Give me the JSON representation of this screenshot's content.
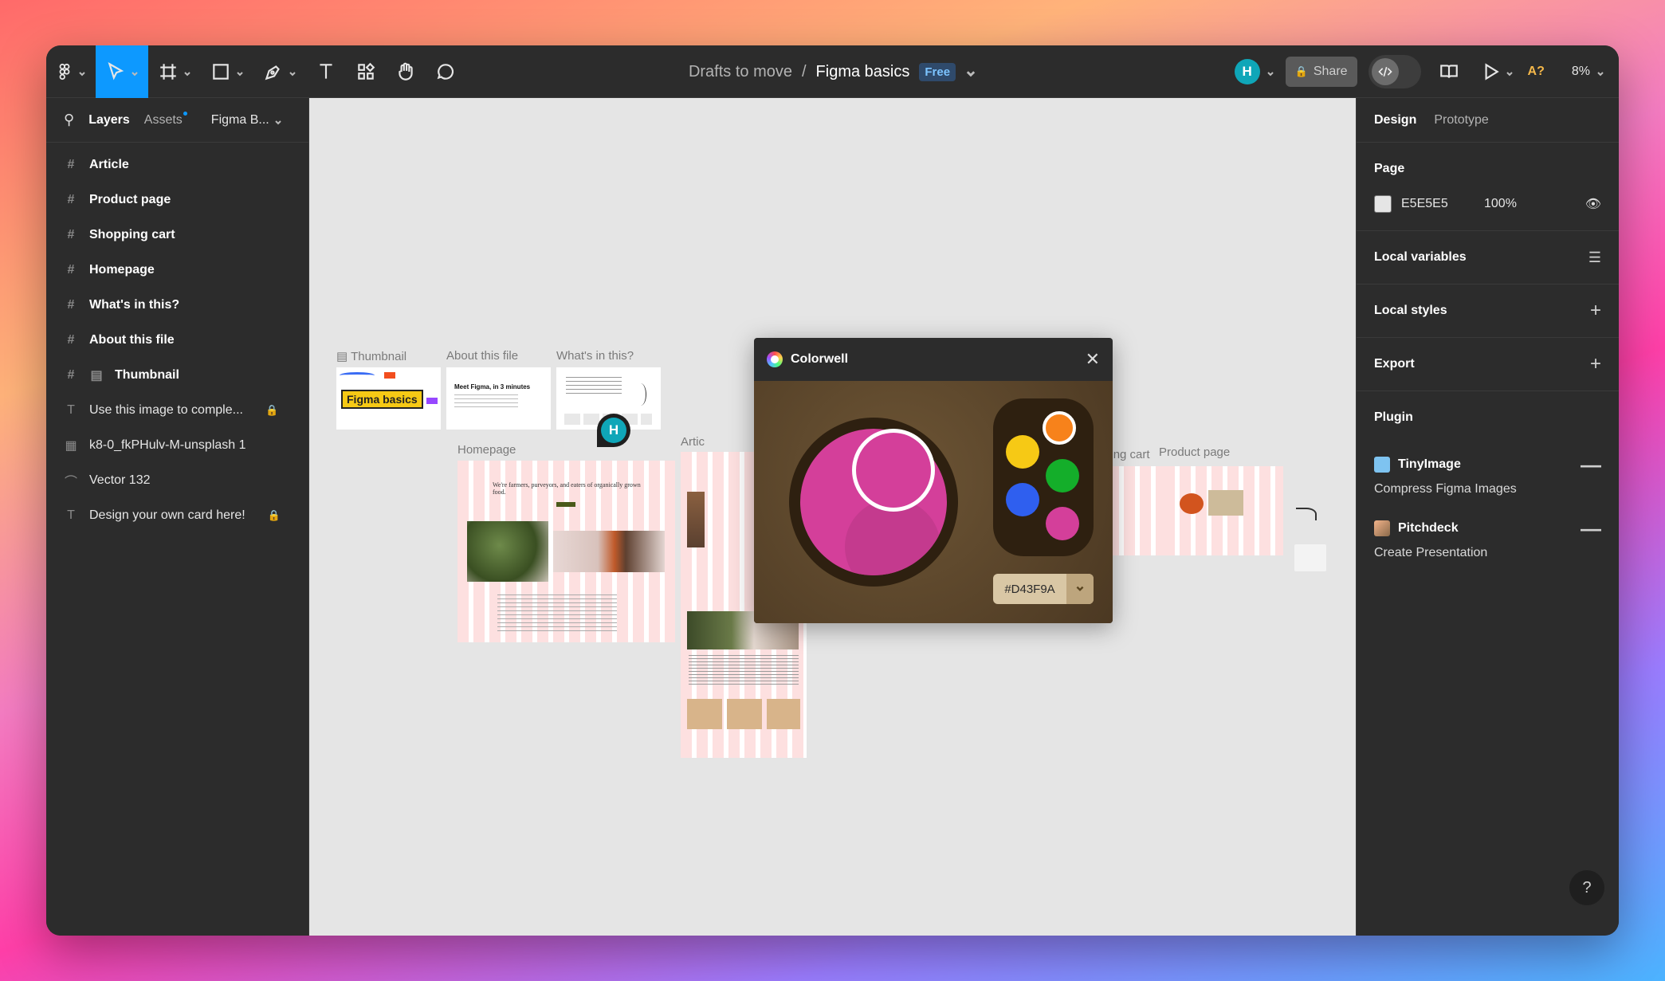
{
  "toolbar": {
    "breadcrumb_project": "Drafts to move",
    "breadcrumb_sep": "/",
    "file_name": "Figma basics",
    "plan_badge": "Free",
    "avatar_initial": "H",
    "share_label": "Share",
    "warning_label": "A?",
    "zoom_level": "8%"
  },
  "left_panel": {
    "tab_layers": "Layers",
    "tab_assets": "Assets",
    "page_name": "Figma B...",
    "layers": [
      {
        "name": "Article",
        "type": "frame"
      },
      {
        "name": "Product page",
        "type": "frame"
      },
      {
        "name": "Shopping cart",
        "type": "frame"
      },
      {
        "name": "Homepage",
        "type": "frame"
      },
      {
        "name": "What's in this?",
        "type": "frame"
      },
      {
        "name": "About this file",
        "type": "frame"
      },
      {
        "name": "Thumbnail",
        "type": "frame"
      },
      {
        "name": "Use this image to comple...",
        "type": "text",
        "locked": true
      },
      {
        "name": "k8-0_fkPHulv-M-unsplash 1",
        "type": "image"
      },
      {
        "name": "Vector 132",
        "type": "vector"
      },
      {
        "name": "Design your own card here!",
        "type": "text",
        "locked": true
      }
    ]
  },
  "right_panel": {
    "tab_design": "Design",
    "tab_prototype": "Prototype",
    "page_section": "Page",
    "page_color": "E5E5E5",
    "page_opacity": "100%",
    "local_variables": "Local variables",
    "local_styles": "Local styles",
    "export": "Export",
    "plugin_section": "Plugin",
    "plugins": [
      {
        "name": "TinyImage",
        "action": "Compress Figma Images"
      },
      {
        "name": "Pitchdeck",
        "action": "Create Presentation"
      }
    ],
    "help": "?"
  },
  "canvas": {
    "frames": {
      "thumbnail": "Thumbnail",
      "about": "About this file",
      "whats_in": "What's in this?",
      "homepage": "Homepage",
      "article": "Artic",
      "shopping_cart": "Shopping cart",
      "product_page": "Product page"
    },
    "thumbnail_text": "Figma basics",
    "about_heading": "Meet Figma, in 3 minutes",
    "homepage_headline": "We're farmers, purveyors, and eaters of organically grown food.",
    "cursor_initial": "H"
  },
  "colorwell": {
    "title": "Colorwell",
    "hex_value": "#D43F9A",
    "selected_color": "#D43F9A",
    "palette": [
      "#F7821B",
      "#F6C915",
      "#14AE2A",
      "#2F5FEF",
      "#D43F9A"
    ]
  }
}
